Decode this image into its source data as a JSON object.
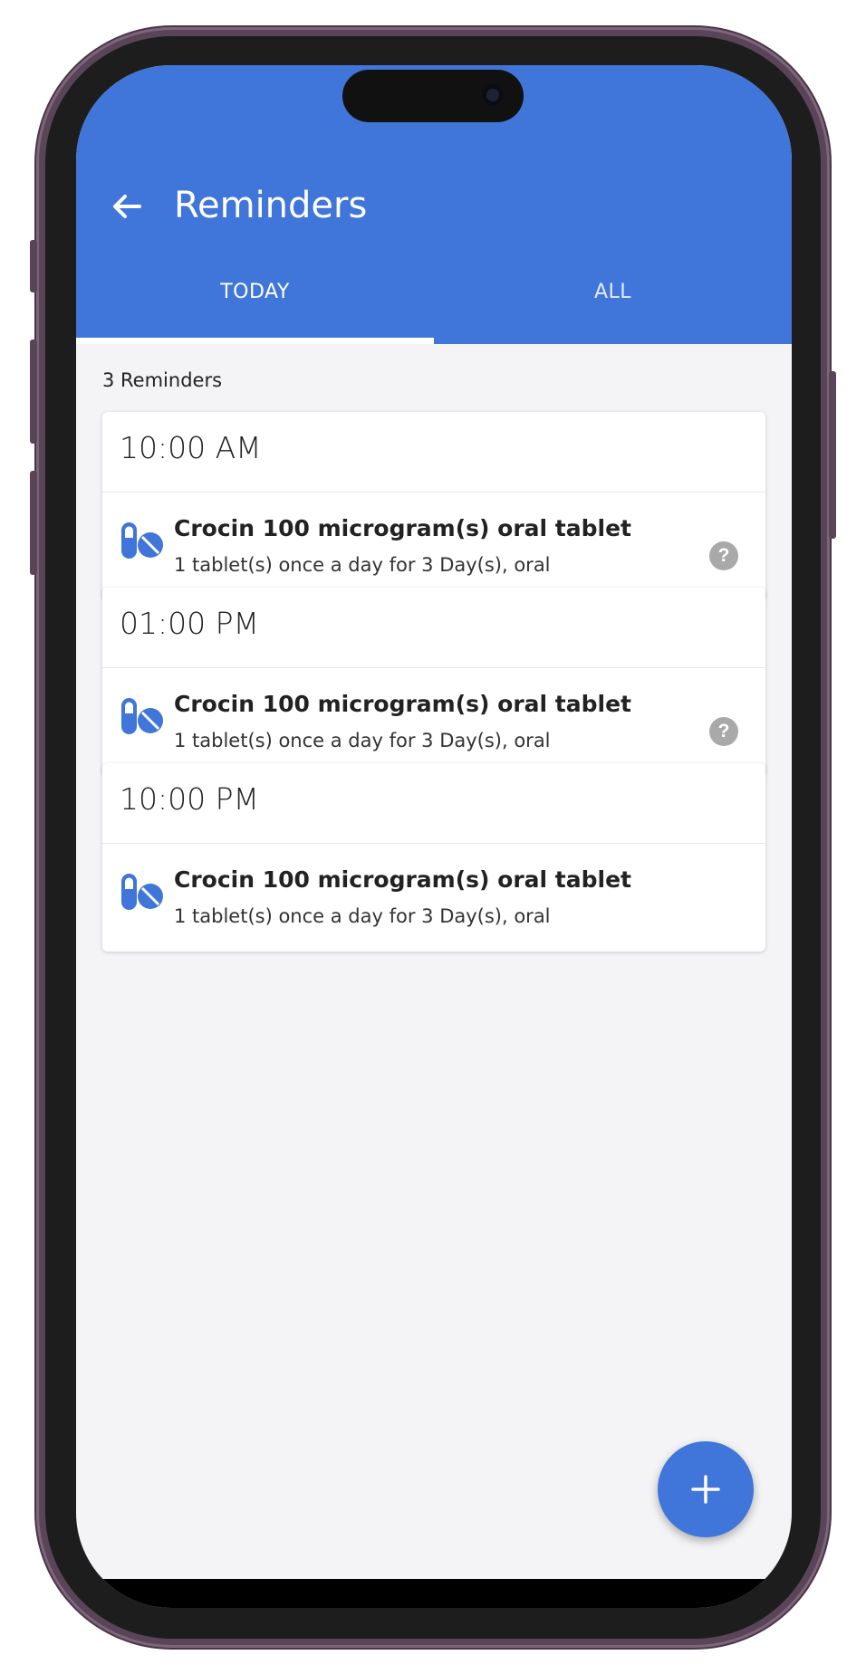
{
  "header": {
    "title": "Reminders",
    "back_icon": "arrow-left-icon"
  },
  "tabs": [
    {
      "label": "TODAY",
      "active": true
    },
    {
      "label": "ALL",
      "active": false
    }
  ],
  "reminders_count": "3 Reminders",
  "reminders": [
    {
      "time": "10:00 AM",
      "medication": "Crocin 100 microgram(s) oral tablet",
      "detail": "1 tablet(s) once a day for 3 Day(s), oral",
      "icon": "pills-icon",
      "has_help": true,
      "help_glyph": "?"
    },
    {
      "time": "01:00 PM",
      "medication": "Crocin 100 microgram(s) oral tablet",
      "detail": "1 tablet(s) once a day for 3 Day(s), oral",
      "icon": "pills-icon",
      "has_help": true,
      "help_glyph": "?"
    },
    {
      "time": "10:00 PM",
      "medication": "Crocin 100 microgram(s) oral tablet",
      "detail": "1 tablet(s) once a day for 3 Day(s), oral",
      "icon": "pills-icon",
      "has_help": false
    }
  ],
  "fab": {
    "icon": "plus-icon"
  },
  "colors": {
    "primary": "#4075d9",
    "background": "#f4f4f7",
    "help_icon": "#a9a9a9",
    "phone_frame": "#5a4457"
  }
}
